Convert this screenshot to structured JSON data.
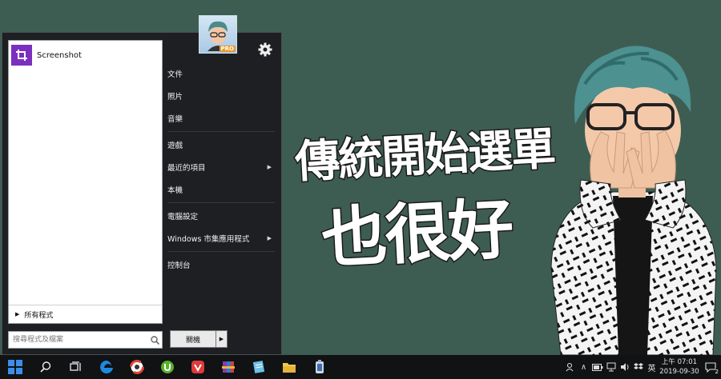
{
  "start_menu": {
    "pinned": [
      {
        "label": "Screenshot",
        "icon": "crop-icon"
      }
    ],
    "all_programs": "所有程式",
    "search_placeholder": "搜尋程式及檔案",
    "shutdown_label": "關機",
    "user_badge": "PRO",
    "right_items": [
      {
        "label": "文件",
        "submenu": false
      },
      {
        "label": "照片",
        "submenu": false
      },
      {
        "label": "音樂",
        "submenu": false
      },
      {
        "label": "遊戲",
        "submenu": false
      },
      {
        "label": "最近的項目",
        "submenu": true
      },
      {
        "label": "本機",
        "submenu": false
      },
      {
        "label": "電腦設定",
        "submenu": false
      },
      {
        "label": "Windows 市集應用程式",
        "submenu": true
      },
      {
        "label": "控制台",
        "submenu": false
      }
    ]
  },
  "headline": {
    "line1": "傳統開始選單",
    "line2": "也很好"
  },
  "taskbar": {
    "apps": [
      "search-icon",
      "task-view-icon",
      "edge-icon",
      "chrome-like-icon",
      "utorrent-icon",
      "vivaldi-icon",
      "winrar-icon",
      "notepad-icon",
      "file-explorer-icon",
      "app-icon"
    ],
    "tray_language": "英",
    "clock_time": "上午 07:01",
    "clock_date": "2019-09-30",
    "notification_count": "2"
  },
  "colors": {
    "desktop": "#3e5d52",
    "menu_bg": "#1d1f22",
    "taskbar": "#101214",
    "accent_purple": "#7b2fbf"
  }
}
